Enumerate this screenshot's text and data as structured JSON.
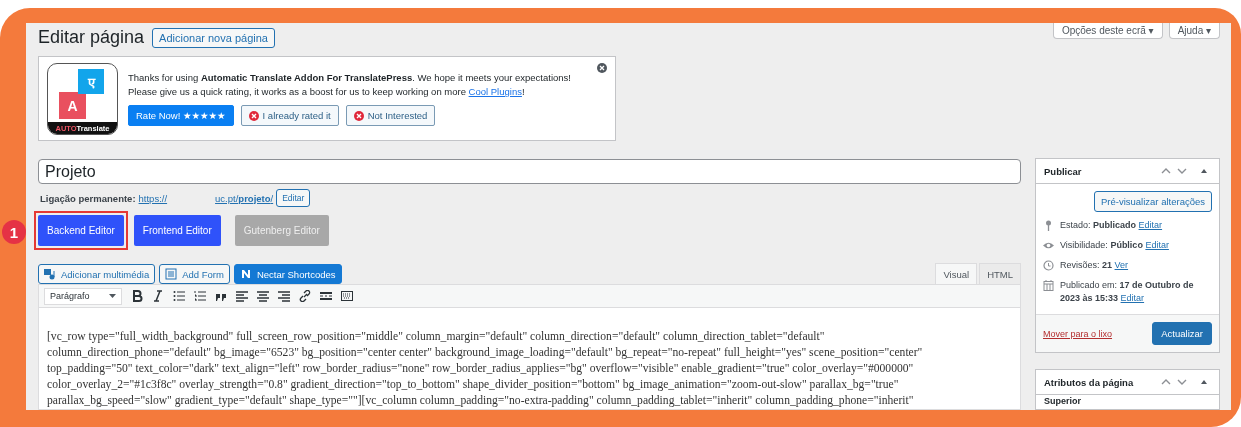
{
  "screen_options": [
    {
      "label": "Opções deste ecrã ▾"
    },
    {
      "label": "Ajuda ▾"
    }
  ],
  "heading": {
    "title": "Editar página",
    "add_new": "Adicionar nova página"
  },
  "notice": {
    "logo_glyph_back": "A",
    "logo_glyph_front": "ए",
    "logo_caption_1": "AUTO",
    "logo_caption_2": "Translate",
    "line_1": "Thanks for using **Automatic Translate Addon For TranslatePress**. We hope it meets your expectations!",
    "line_2": "Please give us a quick rating, it works as a boost for us to keep working on more",
    "link": "Cool Plugins",
    "line_2_end": "!",
    "buttons": [
      {
        "label": "Rate Now! ★★★★★",
        "kind": "primary"
      },
      {
        "label": "I already rated it",
        "kind": "dismiss"
      },
      {
        "label": "Not Interested",
        "kind": "dismiss"
      }
    ]
  },
  "title_field": {
    "value": "Projeto"
  },
  "permalink": {
    "label": "Ligação permanente:",
    "url_start": "https://",
    "url_end": "uc.pt/**projeto**/",
    "edit": "Editar"
  },
  "editor_buttons": [
    {
      "label": "Backend Editor",
      "disabled": false,
      "annotation": "1"
    },
    {
      "label": "Frontend Editor",
      "disabled": false
    },
    {
      "label": "Gutenberg Editor",
      "disabled": true
    }
  ],
  "media_buttons": [
    {
      "label": "Adicionar multimédia",
      "kind": "media"
    },
    {
      "label": "Add Form",
      "kind": "form"
    },
    {
      "label": "Nectar Shortcodes",
      "kind": "nectar"
    }
  ],
  "editor_tabs": [
    {
      "label": "Visual",
      "selected": true
    },
    {
      "label": "HTML",
      "selected": false
    }
  ],
  "format_select": {
    "value": "Parágrafo"
  },
  "content": {
    "lines": [
      "[vc_row type=\"full_width_background\" full_screen_row_position=\"middle\" column_margin=\"default\" column_direction=\"default\" column_direction_tablet=\"default\"",
      "column_direction_phone=\"default\" bg_image=\"6523\" bg_position=\"center center\" background_image_loading=\"default\" bg_repeat=\"no-repeat\" full_height=\"yes\" scene_position=\"center\"",
      "top_padding=\"50\" text_color=\"dark\" text_align=\"left\" row_border_radius=\"none\" row_border_radius_applies=\"bg\" overflow=\"visible\" enable_gradient=\"true\" color_overlay=\"#000000\"",
      "color_overlay_2=\"#1c3f8c\" overlay_strength=\"0.8\" gradient_direction=\"top_to_bottom\" shape_divider_position=\"bottom\" bg_image_animation=\"zoom-out-slow\" parallax_bg=\"true\"",
      "parallax_bg_speed=\"slow\" gradient_type=\"default\" shape_type=\"\"][vc_column column_padding=\"no-extra-padding\" column_padding_tablet=\"inherit\" column_padding_phone=\"inherit\""
    ]
  },
  "publish_box": {
    "title": "Publicar",
    "preview": "Pré-visualizar alterações",
    "rows": [
      {
        "kind": "pin",
        "text": "Estado: **Publicado**",
        "link": "Editar"
      },
      {
        "kind": "eye",
        "text": "Visibilidade: **Público**",
        "link": "Editar"
      },
      {
        "kind": "clock",
        "text": "Revisões: **21**",
        "link": "Ver"
      },
      {
        "kind": "calendar",
        "text": "Publicado em: **17 de Outubro de 2023 às 15:33**",
        "link": "Editar"
      }
    ],
    "trash": "Mover para o lixo",
    "update": "Actualizar"
  },
  "attributes_box": {
    "title": "Atributos da página",
    "first_label": "Superior"
  }
}
